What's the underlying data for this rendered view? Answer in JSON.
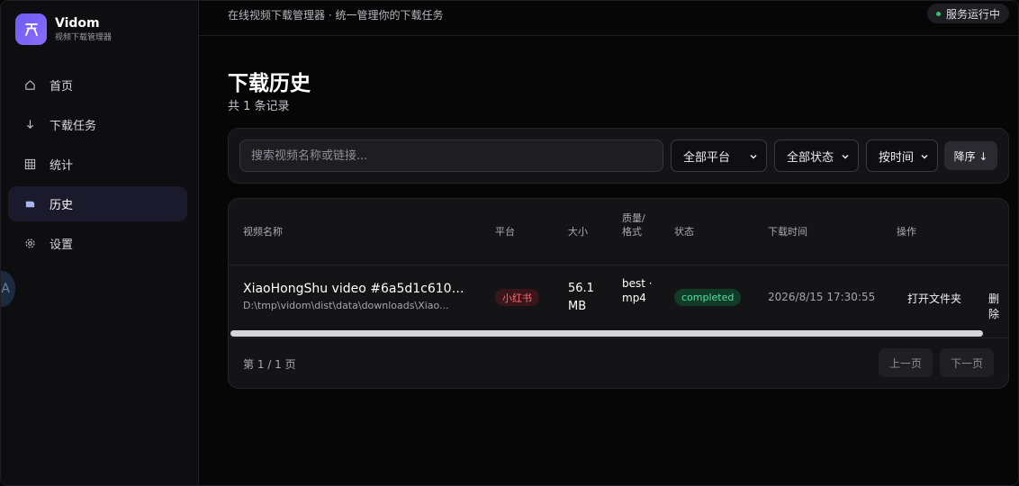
{
  "app": {
    "name": "Vidom",
    "subtitle": "视频下载管理器"
  },
  "sidebar": {
    "items": [
      {
        "label": "首页",
        "icon": "home-icon",
        "active": false
      },
      {
        "label": "下载任务",
        "icon": "download-arrow-icon",
        "active": false
      },
      {
        "label": "统计",
        "icon": "grid-icon",
        "active": false
      },
      {
        "label": "历史",
        "icon": "history-icon",
        "active": true
      },
      {
        "label": "设置",
        "icon": "gear-icon",
        "active": false
      }
    ],
    "avatar_letter": "A"
  },
  "topbar": {
    "description": "在线视频下载管理器 · 统一管理你的下载任务",
    "service_status": "服务运行中"
  },
  "page": {
    "title": "下载历史",
    "record_count": "共 1 条记录"
  },
  "filters": {
    "search_placeholder": "搜索视频名称或链接...",
    "platform": "全部平台",
    "status": "全部状态",
    "sort_by": "按时间",
    "order": "降序 ↓"
  },
  "table": {
    "headers": {
      "name": "视频名称",
      "platform": "平台",
      "size": "大小",
      "quality": "质量/格式",
      "status": "状态",
      "time": "下载时间",
      "actions": "操作"
    },
    "rows": [
      {
        "name": "XiaoHongShu video #6a5d1c61000...",
        "path": "D:\\tmp\\vidom\\dist\\data\\downloads\\Xiao...",
        "platform": "小红书",
        "size": "56.1 MB",
        "quality": "best · mp4",
        "status": "completed",
        "time": "2026/8/15 17:30:55",
        "open_label": "打开文件夹",
        "delete_label": "删除"
      }
    ]
  },
  "pagination": {
    "indicator": "第 1 / 1 页",
    "prev": "上一页",
    "next": "下一页"
  },
  "colors": {
    "accent": "#7060f6",
    "status_ok": "#2fbf71",
    "platform_badge": "#ff6b78",
    "completed_badge": "#4fe3a0"
  }
}
